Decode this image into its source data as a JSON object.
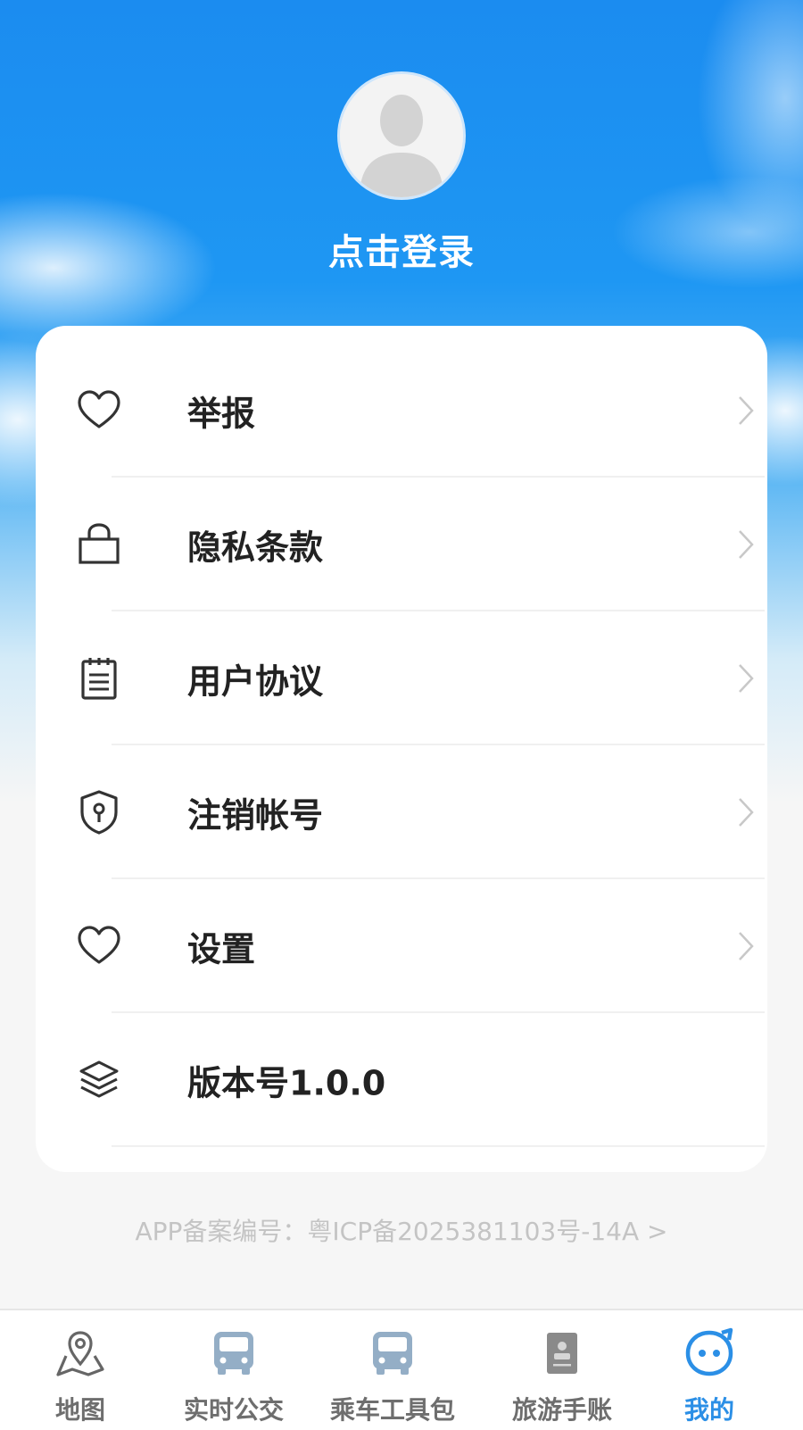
{
  "profile": {
    "login_text": "点击登录"
  },
  "menu": [
    {
      "label": "举报",
      "icon": "heart-icon",
      "arrow": true
    },
    {
      "label": "隐私条款",
      "icon": "bag-icon",
      "arrow": true
    },
    {
      "label": "用户协议",
      "icon": "notepad-icon",
      "arrow": true
    },
    {
      "label": "注销帐号",
      "icon": "shield-keyhole-icon",
      "arrow": true
    },
    {
      "label": "设置",
      "icon": "heart-icon",
      "arrow": true
    },
    {
      "label": "版本号1.0.0",
      "icon": "layers-icon",
      "arrow": false
    }
  ],
  "footer": {
    "icp_text": "APP备案编号：粤ICP备2025381103号-14A >"
  },
  "tabbar": {
    "active_index": 4,
    "tabs": [
      {
        "label": "地图",
        "icon": "map-pin-icon"
      },
      {
        "label": "实时公交",
        "icon": "bus-icon"
      },
      {
        "label": "乘车工具包",
        "icon": "bus-icon"
      },
      {
        "label": "旅游手账",
        "icon": "notebook-icon"
      },
      {
        "label": "我的",
        "icon": "smiley-face-icon"
      }
    ]
  },
  "colors": {
    "accent": "#2b8fe6",
    "sky_top": "#1b8cf0",
    "text_dark": "#222222",
    "text_muted": "#c4c4c4"
  }
}
